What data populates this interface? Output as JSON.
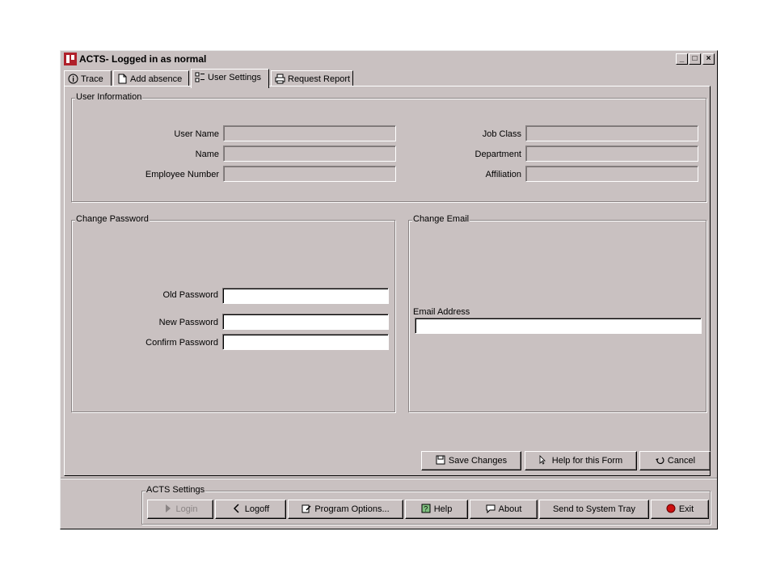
{
  "window": {
    "title": "ACTS- Logged in as normal",
    "controls": {
      "minimize": "_",
      "maximize": "□",
      "close": "×"
    }
  },
  "tabs": [
    {
      "label": "Trace",
      "icon": "info-icon"
    },
    {
      "label": "Add absence",
      "icon": "document-icon"
    },
    {
      "label": "User Settings",
      "icon": "settings-list-icon",
      "active": true
    },
    {
      "label": "Request Report",
      "icon": "printer-icon"
    }
  ],
  "user_info": {
    "title": "User Information",
    "user_name_label": "User Name",
    "name_label": "Name",
    "employee_number_label": "Employee Number",
    "job_class_label": "Job Class",
    "department_label": "Department",
    "affiliation_label": "Affiliation"
  },
  "change_password": {
    "title": "Change Password",
    "old_label": "Old Password",
    "new_label": "New Password",
    "confirm_label": "Confirm Password"
  },
  "change_email": {
    "title": "Change Email",
    "email_label": "Email Address",
    "email_value": ""
  },
  "form_buttons": {
    "save": "Save Changes",
    "help": "Help for this Form",
    "cancel": "Cancel"
  },
  "acts_settings": {
    "title": "ACTS Settings",
    "login": "Login",
    "logoff": "Logoff",
    "program_options": "Program Options...",
    "help": "Help",
    "about": "About",
    "send_to_tray": "Send to System Tray",
    "exit": "Exit"
  },
  "colors": {
    "window_bg": "#c9c1c1",
    "exit_icon": "#cc1010"
  }
}
